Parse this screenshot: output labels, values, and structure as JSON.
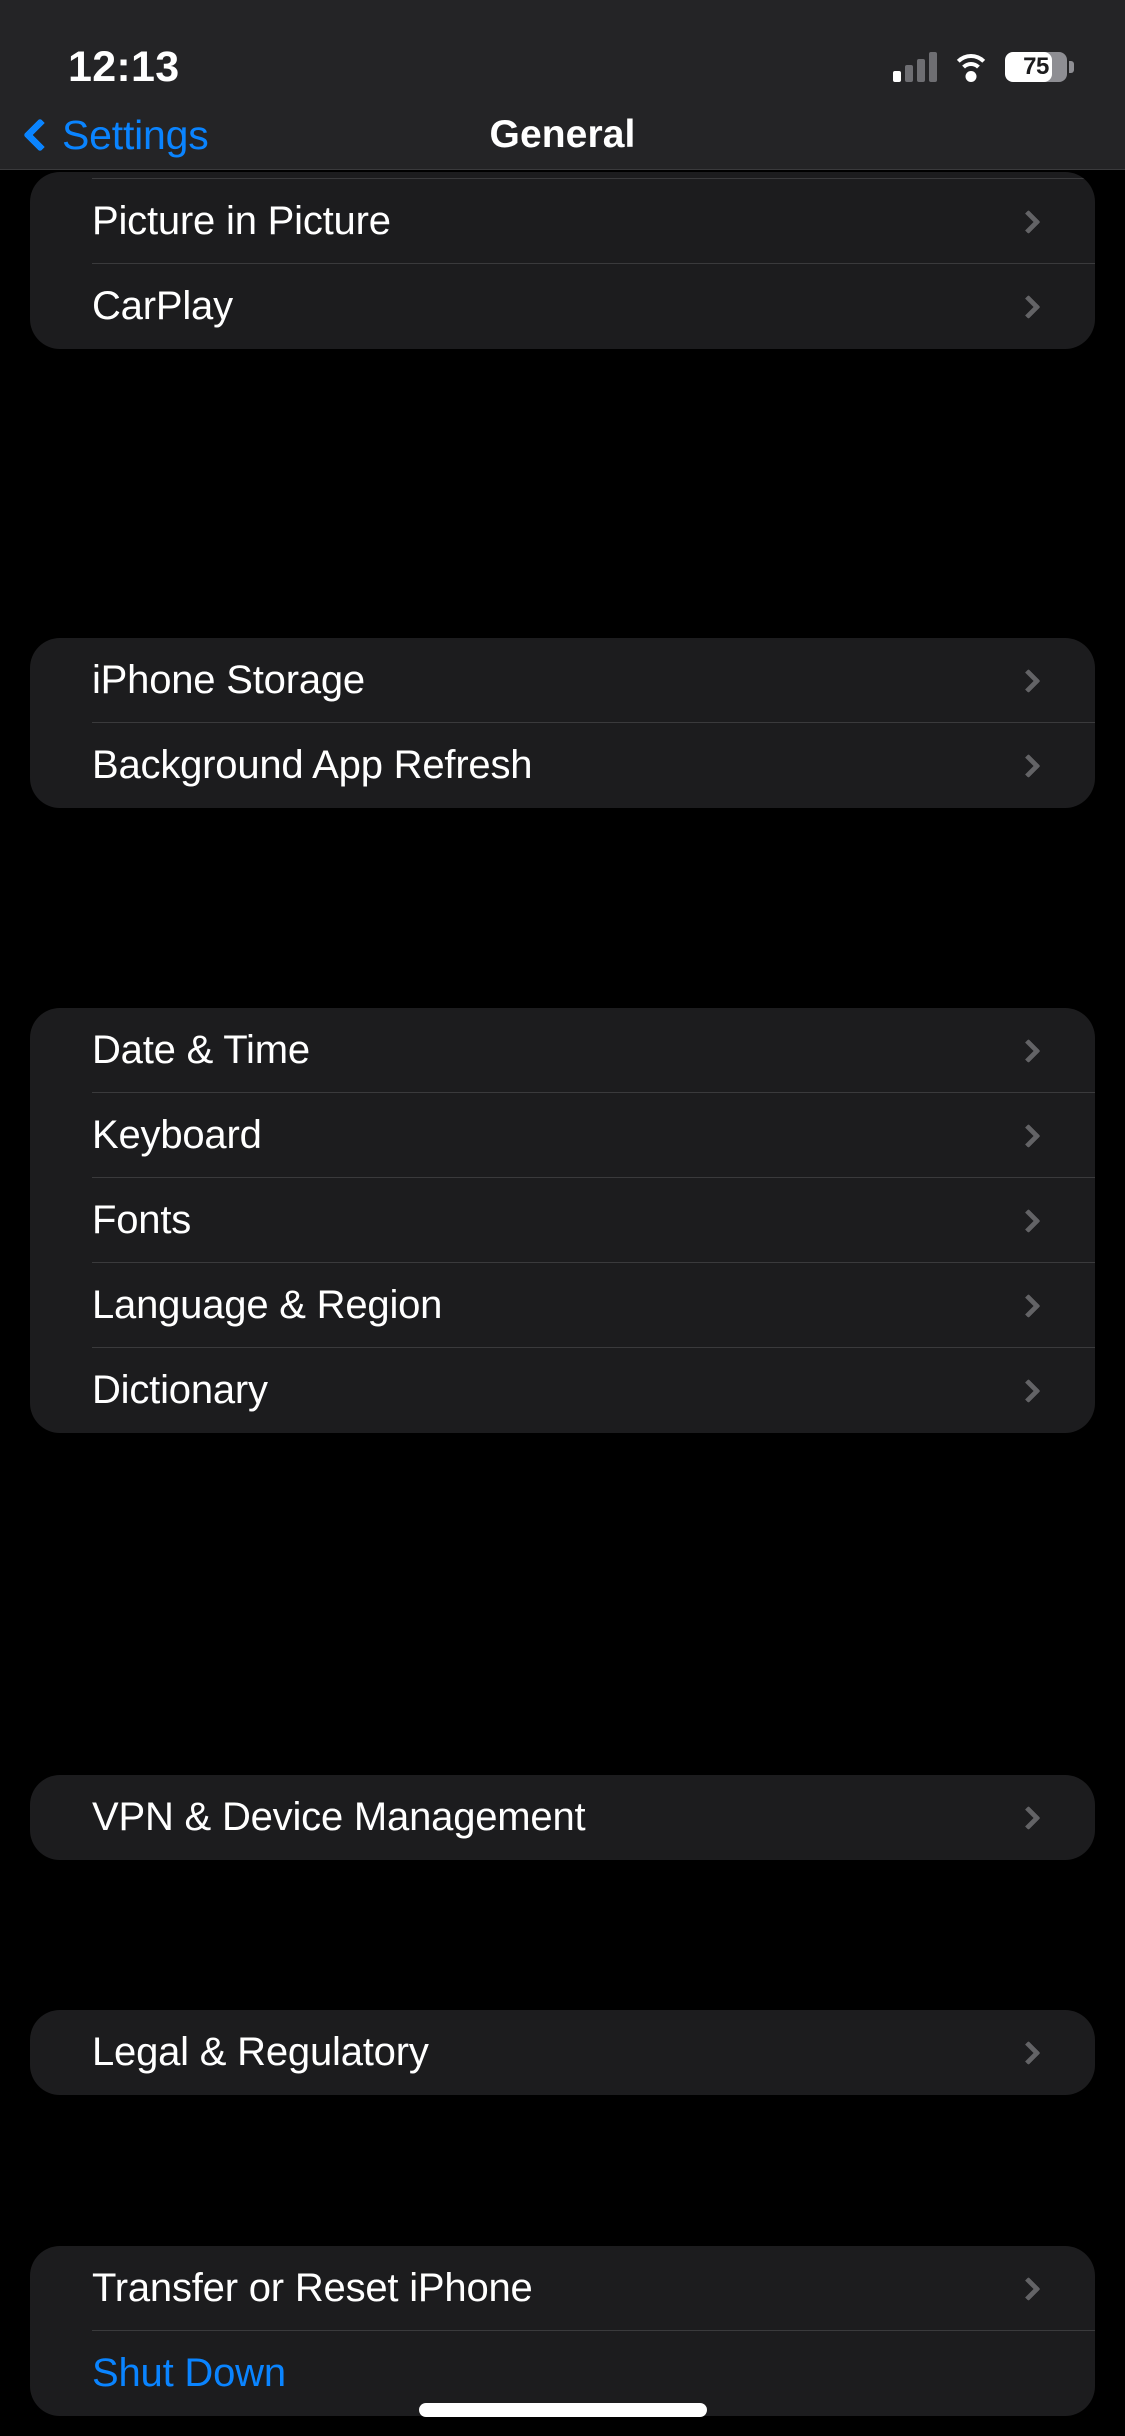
{
  "status_bar": {
    "time": "12:13",
    "battery_percent": "75",
    "battery_level": 75,
    "signal_bars_filled": 1,
    "signal_bars_total": 4,
    "icons": [
      "cellular-signal-icon",
      "wifi-icon",
      "battery-icon"
    ]
  },
  "nav_bar": {
    "back_label": "Settings",
    "title": "General",
    "back_icon": "chevron-left-icon",
    "accent_color": "#0A84FF"
  },
  "colors": {
    "page_background": "#000000",
    "card_background": "#1C1C1E",
    "bar_background": "#242426",
    "separator": "#3A3A3C",
    "primary_text": "#FFFFFF",
    "accent": "#0A84FF",
    "chevron": "#636366"
  },
  "groups": [
    {
      "id": "g0",
      "clipped_top": true,
      "rows": [
        {
          "label": "Picture in Picture",
          "accessory": "chevron-right-icon"
        },
        {
          "label": "CarPlay",
          "accessory": "chevron-right-icon"
        }
      ]
    },
    {
      "id": "g1",
      "rows": [
        {
          "label": "iPhone Storage",
          "accessory": "chevron-right-icon"
        },
        {
          "label": "Background App Refresh",
          "accessory": "chevron-right-icon"
        }
      ]
    },
    {
      "id": "g2",
      "rows": [
        {
          "label": "Date & Time",
          "accessory": "chevron-right-icon"
        },
        {
          "label": "Keyboard",
          "accessory": "chevron-right-icon"
        },
        {
          "label": "Fonts",
          "accessory": "chevron-right-icon"
        },
        {
          "label": "Language & Region",
          "accessory": "chevron-right-icon"
        },
        {
          "label": "Dictionary",
          "accessory": "chevron-right-icon"
        }
      ]
    },
    {
      "id": "g3",
      "rows": [
        {
          "label": "VPN & Device Management",
          "accessory": "chevron-right-icon"
        }
      ]
    },
    {
      "id": "g4",
      "rows": [
        {
          "label": "Legal & Regulatory",
          "accessory": "chevron-right-icon"
        }
      ]
    },
    {
      "id": "g5",
      "clipped_bottom": true,
      "rows": [
        {
          "label": "Transfer or Reset iPhone",
          "accessory": "chevron-right-icon"
        },
        {
          "label": "Shut Down",
          "accent": true,
          "accessory": "none"
        }
      ]
    }
  ]
}
